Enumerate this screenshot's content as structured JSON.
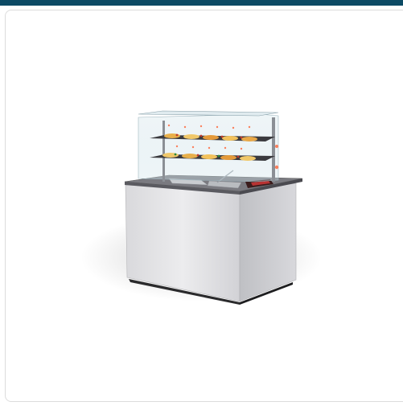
{
  "colors": {
    "top_bar": "#0c4a64",
    "card_border": "#dcdcdc",
    "cabinet_body": "#e4e4e6",
    "glass": "#cfe3ea",
    "counter_top": "#6b6b70",
    "heat_glow": "#ff5a2a"
  },
  "product": {
    "image_icon": "food-display-counter-icon"
  }
}
